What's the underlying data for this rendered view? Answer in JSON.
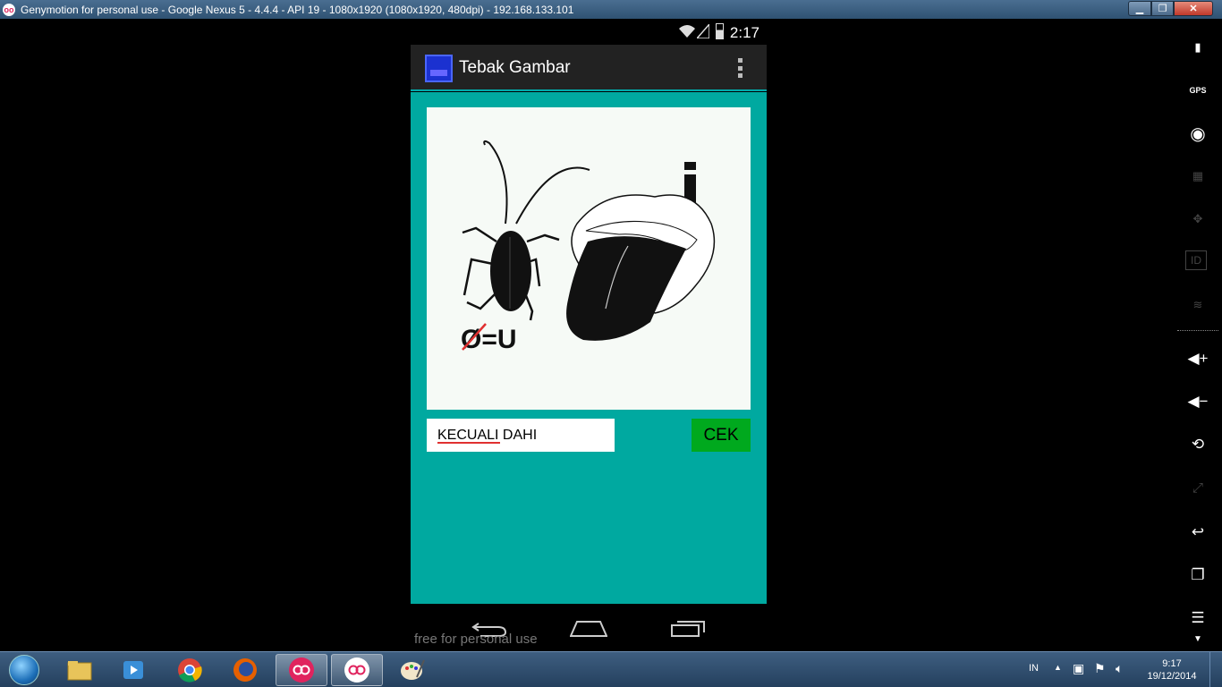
{
  "window": {
    "title": "Genymotion for personal use - Google Nexus 5 - 4.4.4 - API 19 - 1080x1920 (1080x1920, 480dpi) - 192.168.133.101",
    "app_icon_text": "oo"
  },
  "status_bar": {
    "time": "2:17"
  },
  "action_bar": {
    "title": "Tebak Gambar"
  },
  "puzzle": {
    "caption": "Ø=U",
    "letter": "i"
  },
  "answer": {
    "value": "KECUALI DAHI"
  },
  "check_button": {
    "label": "CEK"
  },
  "watermark": "free for personal use",
  "taskbar": {
    "language": "IN",
    "clock_time": "9:17",
    "clock_date": "19/12/2014"
  },
  "colors": {
    "content_bg": "#00a9a0",
    "button_bg": "#00a91e",
    "action_bar_bg": "#222222"
  }
}
